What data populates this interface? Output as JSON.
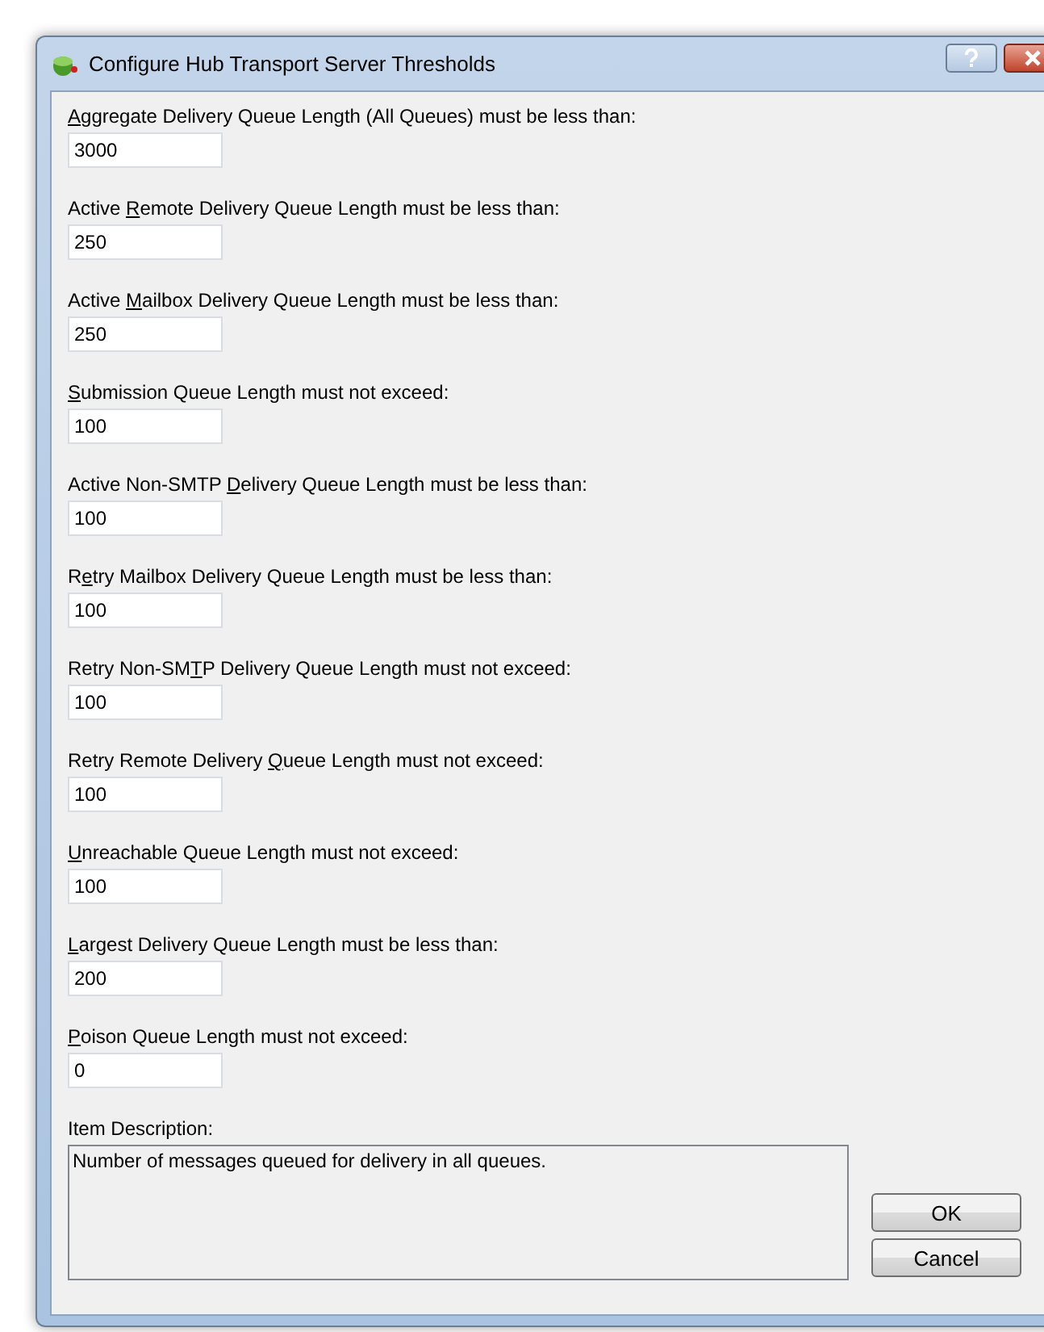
{
  "window": {
    "title": "Configure Hub Transport Server Thresholds"
  },
  "fields": [
    {
      "label": {
        "key": "A",
        "post": "ggregate Delivery Queue Length (All Queues) must be less than:"
      },
      "value": "3000"
    },
    {
      "label": {
        "pre": "Active ",
        "key": "R",
        "post": "emote Delivery Queue Length must be less than:"
      },
      "value": "250"
    },
    {
      "label": {
        "pre": "Active ",
        "key": "M",
        "post": "ailbox Delivery Queue Length must be less than:"
      },
      "value": "250"
    },
    {
      "label": {
        "key": "S",
        "post": "ubmission Queue Length must not exceed:"
      },
      "value": "100"
    },
    {
      "label": {
        "pre": "Active Non-SMTP ",
        "key": "D",
        "post": "elivery Queue Length must be less than:"
      },
      "value": "100"
    },
    {
      "label": {
        "pre": "R",
        "key": "e",
        "post": "try Mailbox Delivery Queue Length must be less than:"
      },
      "value": "100"
    },
    {
      "label": {
        "pre": "Retry Non-SM",
        "key": "T",
        "post": "P Delivery Queue Length must not exceed:"
      },
      "value": "100"
    },
    {
      "label": {
        "pre": "Retry Remote Delivery ",
        "key": "Q",
        "post": "ueue Length must not exceed:"
      },
      "value": "100"
    },
    {
      "label": {
        "key": "U",
        "post": "nreachable Queue Length must not exceed:"
      },
      "value": "100"
    },
    {
      "label": {
        "key": "L",
        "post": "argest Delivery Queue Length must be less than:"
      },
      "value": "200"
    },
    {
      "label": {
        "key": "P",
        "post": "oison Queue Length must not exceed:"
      },
      "value": "0"
    }
  ],
  "description": {
    "label": "Item Description:",
    "text": "Number of messages queued for delivery in all queues."
  },
  "buttons": [
    "OK",
    "Cancel"
  ]
}
